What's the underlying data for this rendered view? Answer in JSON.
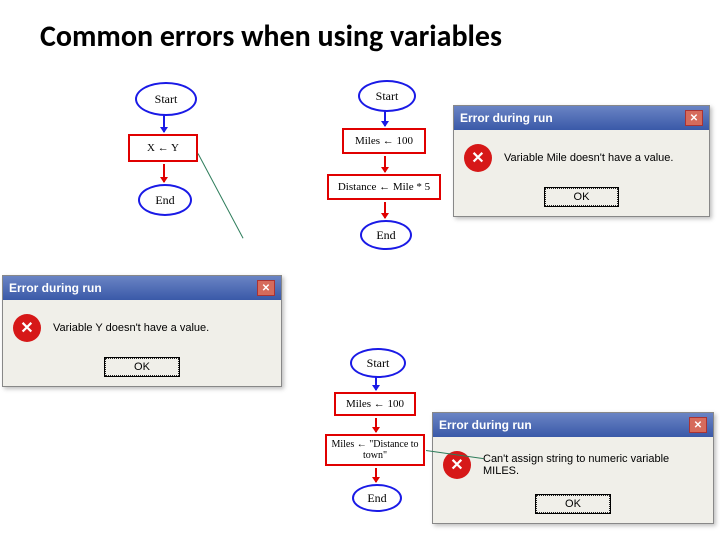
{
  "title": "Common errors when using variables",
  "flowcharts": {
    "fc1": {
      "start": "Start",
      "step": "X ← Y",
      "end": "End"
    },
    "fc2": {
      "start": "Start",
      "step1": "Miles ← 100",
      "step2": "Distance ← Mile * 5",
      "end": "End"
    },
    "fc3": {
      "start": "Start",
      "step1": "Miles ← 100",
      "step2": "Miles ← \"Distance to town\"",
      "end": "End"
    }
  },
  "dialog_title": "Error during run",
  "dialogs": {
    "d1": {
      "msg": "Variable Y doesn't have a value."
    },
    "d2": {
      "msg": "Variable Mile doesn't have a value."
    },
    "d3": {
      "msg": "Can't assign string to numeric variable MILES."
    }
  },
  "ok_label": "OK"
}
